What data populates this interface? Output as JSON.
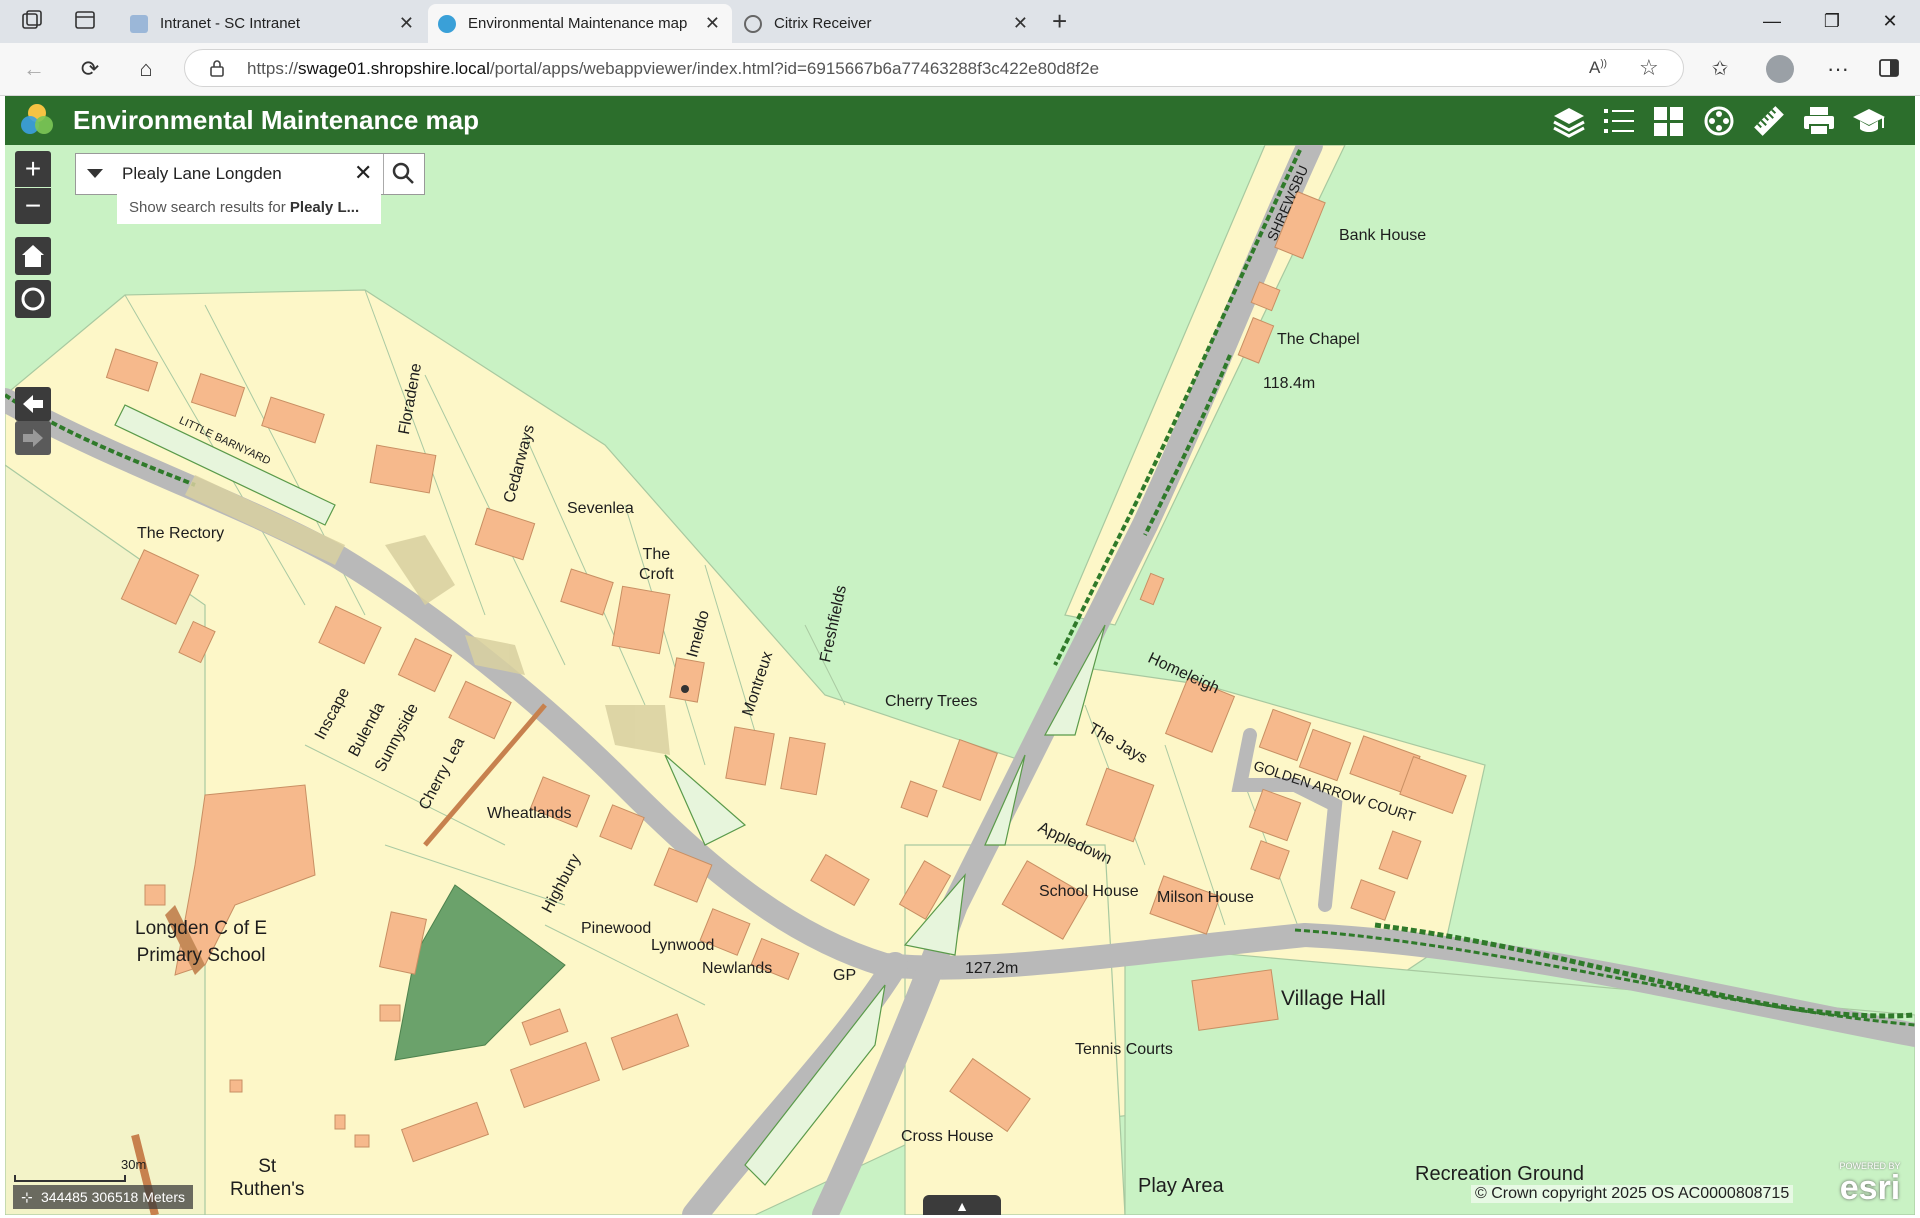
{
  "browser": {
    "tabs": [
      {
        "title": "Intranet - SC Intranet",
        "active": false
      },
      {
        "title": "Environmental Maintenance map",
        "active": true
      },
      {
        "title": "Citrix Receiver",
        "active": false
      }
    ],
    "url_prefix": "https://",
    "url_host": "swage01.shropshire.local",
    "url_path": "/portal/apps/webappviewer/index.html?id=6915667b6a77463288f3c422e80d8f2e"
  },
  "app": {
    "title": "Environmental Maintenance map",
    "header_icons": [
      "layers-icon",
      "legend-list-icon",
      "basemap-grid-icon",
      "film-reel-icon",
      "measure-ruler-icon",
      "print-icon",
      "education-cap-icon"
    ]
  },
  "search": {
    "value": "Plealy Lane Longden",
    "hint_prefix": "Show search results for ",
    "hint_bold": "Plealy L..."
  },
  "map": {
    "labels": {
      "bank_house": "Bank House",
      "the_chapel": "The Chapel",
      "spot_118": "118.4m",
      "shrewsbury": "SHREWSBU",
      "little_barnyard": "LITTLE BARNYARD",
      "floradene": "Floradene",
      "cedarways": "Cedarways",
      "sevenlea": "Sevenlea",
      "the_rectory": "The Rectory",
      "the_croft": "The\nCroft",
      "imeldo": "Imeldo",
      "freshfields": "Freshfields",
      "montreux": "Montreux",
      "cherry_trees": "Cherry Trees",
      "homeleigh": "Homeleigh",
      "the_jays": "The Jays",
      "golden_arrow_court": "GOLDEN ARROW COURT",
      "inscape": "Inscape",
      "bulenda": "Bulenda",
      "sunnyside": "Sunnyside",
      "cherry_lea": "Cherry Lea",
      "wheatlands": "Wheatlands",
      "highbury": "Highbury",
      "appledown": "Appledown",
      "school_house": "School House",
      "milson_house": "Milson House",
      "longden_school": "Longden C of E\nPrimary School",
      "pinewood": "Pinewood",
      "lynwood": "Lynwood",
      "newlands": "Newlands",
      "gp": "GP",
      "spot_127": "127.2m",
      "village_hall": "Village Hall",
      "tennis_courts": "Tennis Courts",
      "cross_house": "Cross House",
      "play_area": "Play Area",
      "recreation_ground": "Recreation Ground",
      "st_ruthens": "St\nRuthen's",
      "scale": "30m"
    },
    "coords": "344485 306518 Meters",
    "copyright": "© Crown copyright 2025 OS AC0000808715",
    "esri_small": "POWERED BY",
    "esri": "esri"
  },
  "colors": {
    "header_green": "#2c6e2c",
    "map_green": "#c9f2c4",
    "building": "#f6b98c",
    "land": "#fdf7c8",
    "road": "#b9b9b9",
    "hedge": "#2f7a2a",
    "woodland": "#6ba26b"
  }
}
